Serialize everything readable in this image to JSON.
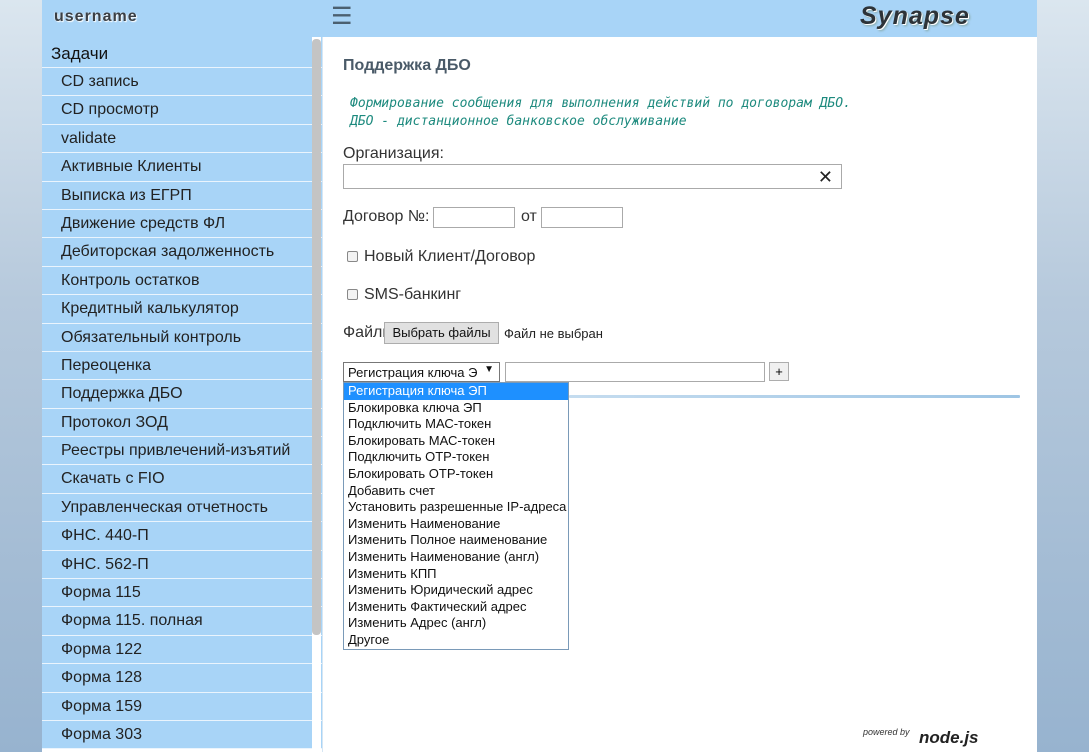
{
  "header": {
    "username": "username",
    "menu_icon": "hamburger-icon",
    "brand": "Synapse"
  },
  "sidebar": {
    "title": "Задачи",
    "items": [
      "CD запись",
      "CD просмотр",
      "validate",
      "Активные Клиенты",
      "Выписка из ЕГРП",
      "Движение средств ФЛ",
      "Дебиторская задолженность",
      "Контроль остатков",
      "Кредитный калькулятор",
      "Обязательный контроль",
      "Переоценка",
      "Поддержка ДБО",
      "Протокол ЗОД",
      "Реестры привлечений-изъятий",
      "Скачать с FIO",
      "Управленческая отчетность",
      "ФНС. 440-П",
      "ФНС. 562-П",
      "Форма 115",
      "Форма 115. полная",
      "Форма 122",
      "Форма 128",
      "Форма 159",
      "Форма 303"
    ]
  },
  "main": {
    "title": "Поддержка ДБО",
    "description_line1": "Формирование сообщения для выполнения действий по договорам ДБО.",
    "description_line2": "ДБО - дистанционное банковское обслуживание",
    "org_label": "Организация:",
    "org_value": "",
    "clear_icon": "close-icon",
    "contract_label": "Договор №:",
    "contract_number": "",
    "date_label": "от",
    "contract_date": "",
    "new_client_label": "Новый Клиент/Договор",
    "new_client_checked": false,
    "sms_label": "SMS-банкинг",
    "sms_checked": false,
    "files_label": "Файлы:",
    "files_button": "Выбрать файлы",
    "files_status": "Файл не выбран",
    "action_selected": "Регистрация ключа Э",
    "action_text": "",
    "add_button": "+",
    "dropdown_options": [
      "Регистрация ключа ЭП",
      "Блокировка ключа ЭП",
      "Подключить МАС-токен",
      "Блокировать МАС-токен",
      "Подключить ОТР-токен",
      "Блокировать ОТР-токен",
      "Добавить счет",
      "Установить разрешенные IP-адреса",
      "Изменить Наименование",
      "Изменить Полное наименование",
      "Изменить Наименование (англ)",
      "Изменить КПП",
      "Изменить Юридический адрес",
      "Изменить Фактический адрес",
      "Изменить Адрес (англ)",
      "Другое"
    ],
    "dropdown_highlighted_index": 0
  },
  "footer": {
    "powered_by": "powered by",
    "engine": "node.js"
  }
}
